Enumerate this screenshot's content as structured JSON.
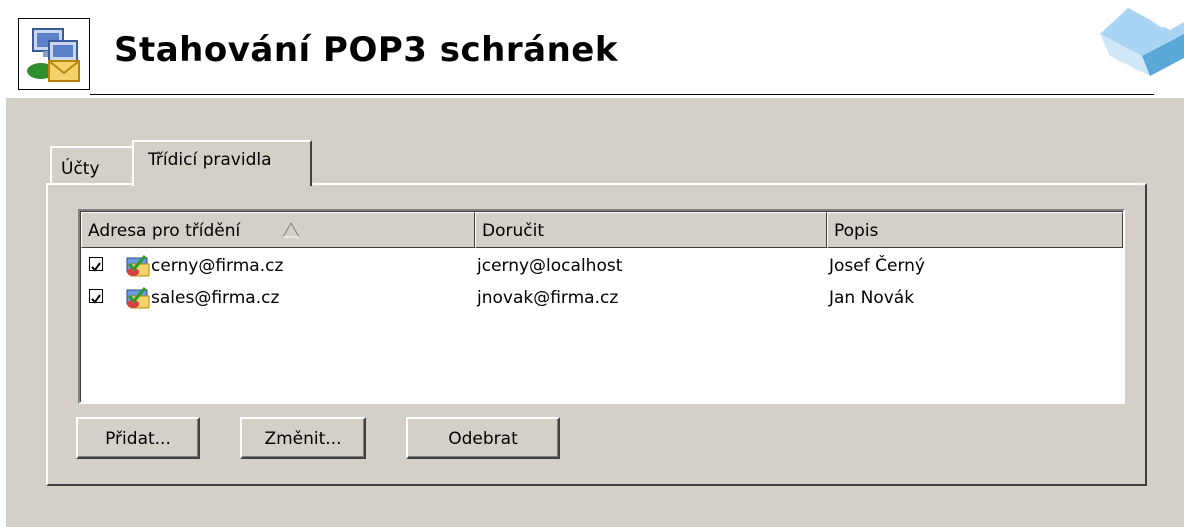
{
  "header": {
    "title": "Stahování POP3 schránek",
    "app_icon": "mail-download-icon",
    "corner_logo": "kerio-logo"
  },
  "tabs": [
    {
      "label": "Účty",
      "active": false
    },
    {
      "label": "Třídicí pravidla",
      "active": true
    }
  ],
  "list": {
    "columns": [
      {
        "label": "Adresa pro třídění",
        "sorted": "ascending"
      },
      {
        "label": "Doručit"
      },
      {
        "label": "Popis"
      }
    ],
    "rows": [
      {
        "checked": true,
        "icon": "rule-check-icon",
        "address": "cerny@firma.cz",
        "deliver": "jcerny@localhost",
        "description": "Josef Černý"
      },
      {
        "checked": true,
        "icon": "rule-check-icon",
        "address": "sales@firma.cz",
        "deliver": "jnovak@firma.cz",
        "description": "Jan Novák"
      }
    ]
  },
  "buttons": {
    "add": {
      "label": "Přidat...",
      "accel": "d"
    },
    "edit": {
      "label": "Změnit...",
      "accel": "Z"
    },
    "remove": {
      "label": "Odebrat",
      "accel": "r"
    }
  },
  "colors": {
    "panel": "#d4d0c8",
    "list_bg": "#ffffff",
    "logo_blue": "#5aa7d8"
  }
}
